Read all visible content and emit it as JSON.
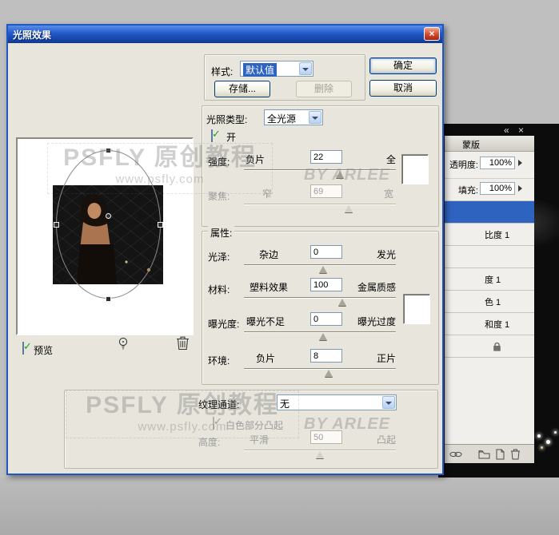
{
  "window": {
    "title": "光照效果",
    "close_glyph": "×"
  },
  "style_group": {
    "label": "样式:",
    "value": "默认值",
    "save_button": "存储...",
    "delete_button": "删除"
  },
  "actions": {
    "ok": "确定",
    "cancel": "取消"
  },
  "light_section": {
    "type_label": "光照类型:",
    "type_value": "全光源",
    "on_label": "开",
    "intensity": {
      "label": "强度:",
      "min": "负片",
      "value": "22",
      "max": "全"
    },
    "focus": {
      "label": "聚焦:",
      "min": "窄",
      "value": "69",
      "max": "宽"
    }
  },
  "properties_section": {
    "label": "属性:",
    "gloss": {
      "label": "光泽:",
      "min": "杂边",
      "value": "0",
      "max": "发光"
    },
    "material": {
      "label": "材料:",
      "min": "塑料效果",
      "value": "100",
      "max": "金属质感"
    },
    "exposure": {
      "label": "曝光度:",
      "min": "曝光不足",
      "value": "0",
      "max": "曝光过度"
    },
    "ambience": {
      "label": "环境:",
      "min": "负片",
      "value": "8",
      "max": "正片"
    }
  },
  "texture_section": {
    "label": "纹理通道:",
    "value": "无",
    "white_high_label": "白色部分凸起",
    "height": {
      "label": "高度:",
      "min": "平滑",
      "value": "50",
      "max": "凸起"
    }
  },
  "preview": {
    "label": "预览"
  },
  "watermark": {
    "title": "PSFLY 原创教程",
    "url": "www.psfly.com",
    "byline": "BY ARLEE"
  },
  "layers_panel": {
    "collapse_glyph": "«",
    "close_glyph": "×",
    "tab": "蒙版",
    "opacity_label": "透明度:",
    "opacity_value": "100%",
    "fill_label": "填充:",
    "fill_value": "100%",
    "layers": [
      "比度 1",
      "",
      "度 1",
      "色 1",
      "和度 1"
    ]
  }
}
